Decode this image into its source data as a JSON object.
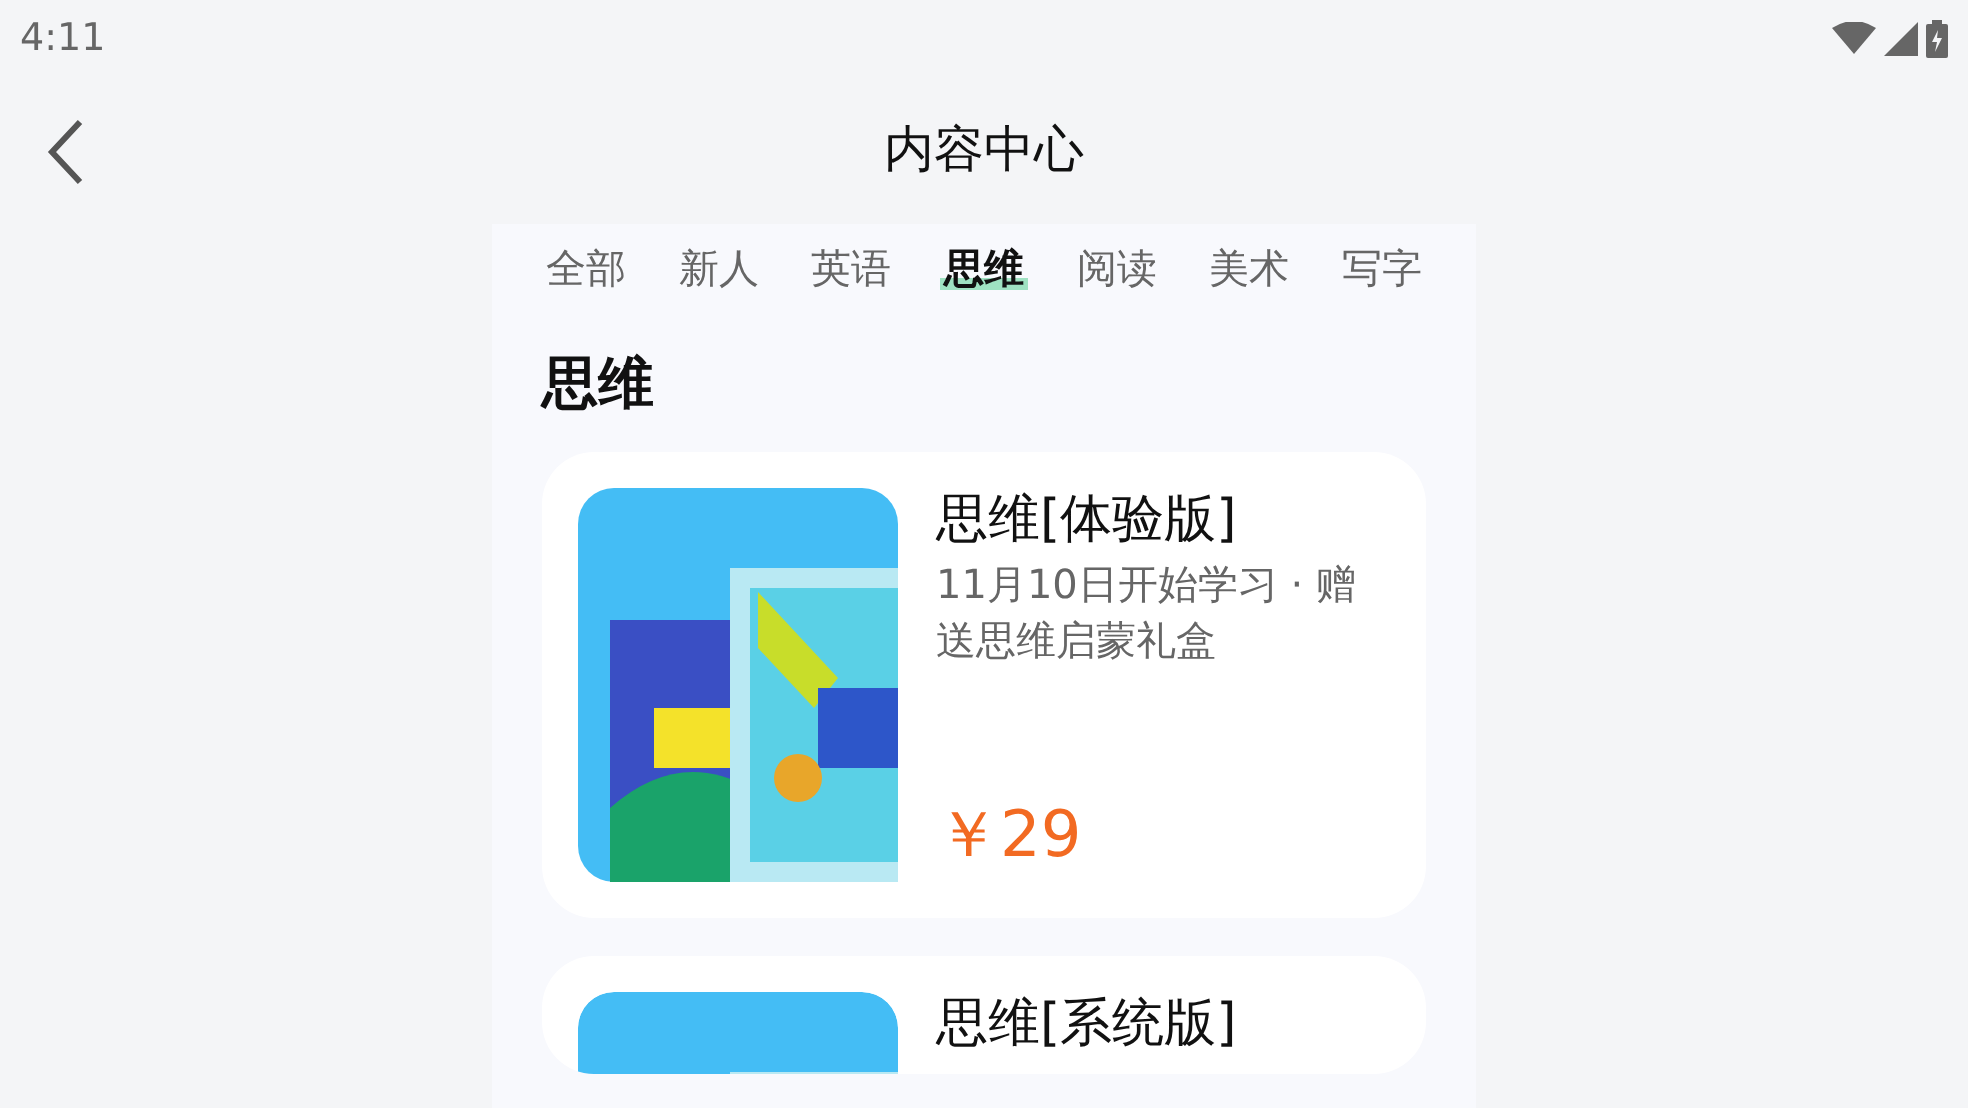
{
  "status_bar": {
    "time": "4:11"
  },
  "header": {
    "title": "内容中心"
  },
  "tabs": [
    {
      "label": "全部",
      "selected": false
    },
    {
      "label": "新人",
      "selected": false
    },
    {
      "label": "英语",
      "selected": false
    },
    {
      "label": "思维",
      "selected": true
    },
    {
      "label": "阅读",
      "selected": false
    },
    {
      "label": "美术",
      "selected": false
    },
    {
      "label": "写字",
      "selected": false
    }
  ],
  "section": {
    "title": "思维"
  },
  "courses": [
    {
      "title": "思维[体验版]",
      "description": "11月10日开始学习 · 赠送思维启蒙礼盒",
      "price": "￥29"
    },
    {
      "title": "思维[系统版]"
    }
  ]
}
